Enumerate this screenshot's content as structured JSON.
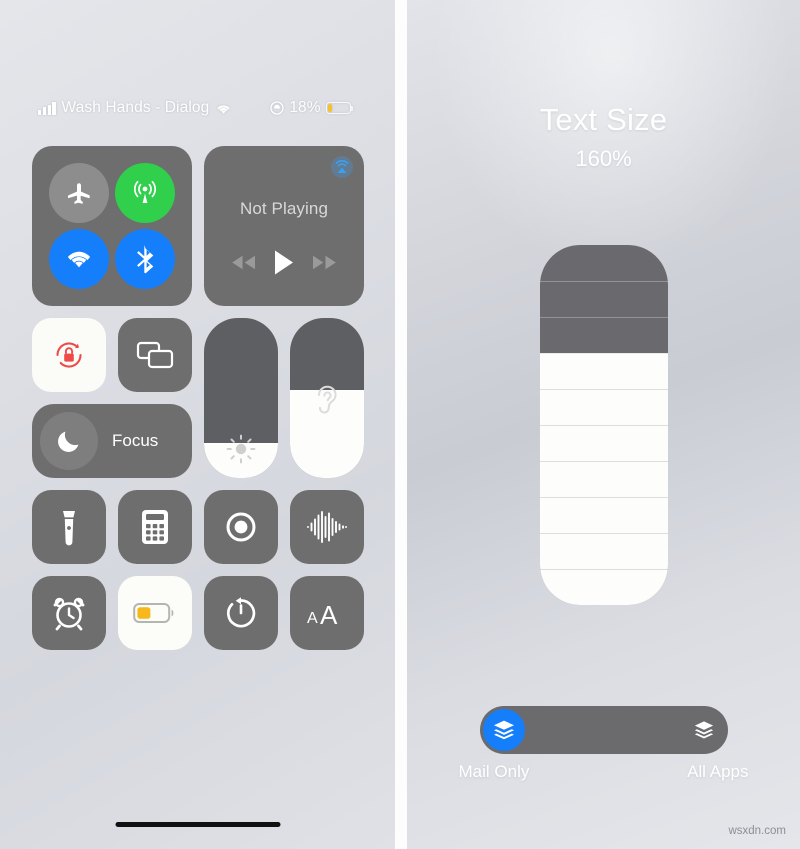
{
  "status_bar": {
    "signal_icon": "signal-bars-icon",
    "carrier": "Wash Hands - Dialog",
    "wifi_icon": "wifi-icon",
    "location_icon": "location-services-icon",
    "battery_percent": "18%",
    "battery_level": 18,
    "battery_icon": "battery-low-icon",
    "battery_color": "#f6c22c"
  },
  "control_center": {
    "connectivity": {
      "name": "connectivity-module",
      "toggles": [
        {
          "name": "airplane-mode-toggle",
          "icon": "airplane-icon",
          "state": "off",
          "color": "#8d8d8d"
        },
        {
          "name": "cellular-data-toggle",
          "icon": "cellular-antenna-icon",
          "state": "on",
          "color": "#30cf4c"
        },
        {
          "name": "wifi-toggle",
          "icon": "wifi-icon",
          "state": "on",
          "color": "#157efb"
        },
        {
          "name": "bluetooth-toggle",
          "icon": "bluetooth-icon",
          "state": "on",
          "color": "#157efb"
        }
      ]
    },
    "media": {
      "name": "now-playing-module",
      "title": "Not Playing",
      "airplay_icon": "airplay-audio-icon",
      "airplay_color": "#3c9ff0",
      "controls": [
        {
          "name": "rewind-button",
          "icon": "rewind-icon"
        },
        {
          "name": "play-button",
          "icon": "play-icon"
        },
        {
          "name": "fast-forward-button",
          "icon": "fast-forward-icon"
        }
      ]
    },
    "rotation_lock": {
      "name": "rotation-lock-toggle",
      "icon": "rotation-lock-icon",
      "state": "on",
      "icon_color": "#ef4a4a"
    },
    "screen_mirroring": {
      "name": "screen-mirroring-button",
      "icon": "screen-mirroring-icon",
      "state": "off"
    },
    "focus": {
      "name": "focus-button",
      "label": "Focus",
      "icon": "moon-icon"
    },
    "brightness": {
      "name": "brightness-slider",
      "icon": "brightness-sun-icon",
      "value": 22
    },
    "volume": {
      "name": "volume-hearing-slider",
      "icon": "ear-icon",
      "value": 55
    },
    "tiles": [
      {
        "name": "flashlight-button",
        "icon": "flashlight-icon",
        "state": "off"
      },
      {
        "name": "calculator-button",
        "icon": "calculator-icon",
        "state": "off"
      },
      {
        "name": "camera-button",
        "icon": "camera-icon",
        "state": "off"
      },
      {
        "name": "sound-recognition-button",
        "icon": "sound-waveform-icon",
        "state": "off"
      },
      {
        "name": "alarm-button",
        "icon": "alarm-clock-icon",
        "state": "off"
      },
      {
        "name": "low-power-mode-button",
        "icon": "battery-low-power-icon",
        "state": "on"
      },
      {
        "name": "timer-button",
        "icon": "timer-icon",
        "state": "off"
      },
      {
        "name": "text-size-button",
        "icon": "text-size-aa-icon",
        "state": "off"
      }
    ],
    "home_indicator": "home-indicator"
  },
  "text_size_panel": {
    "title": "Text Size",
    "value": "160%",
    "slider": {
      "name": "text-size-slider",
      "segments_total": 10,
      "segments_filled": 7
    },
    "scope_toggle": {
      "name": "text-size-scope-toggle",
      "selected": "Mail Only",
      "left_label": "Mail Only",
      "right_label": "All Apps",
      "knob_icon": "layers-icon",
      "right_icon": "layers-icon",
      "accent_color": "#157efb"
    }
  },
  "watermark": "wsxdn.com"
}
